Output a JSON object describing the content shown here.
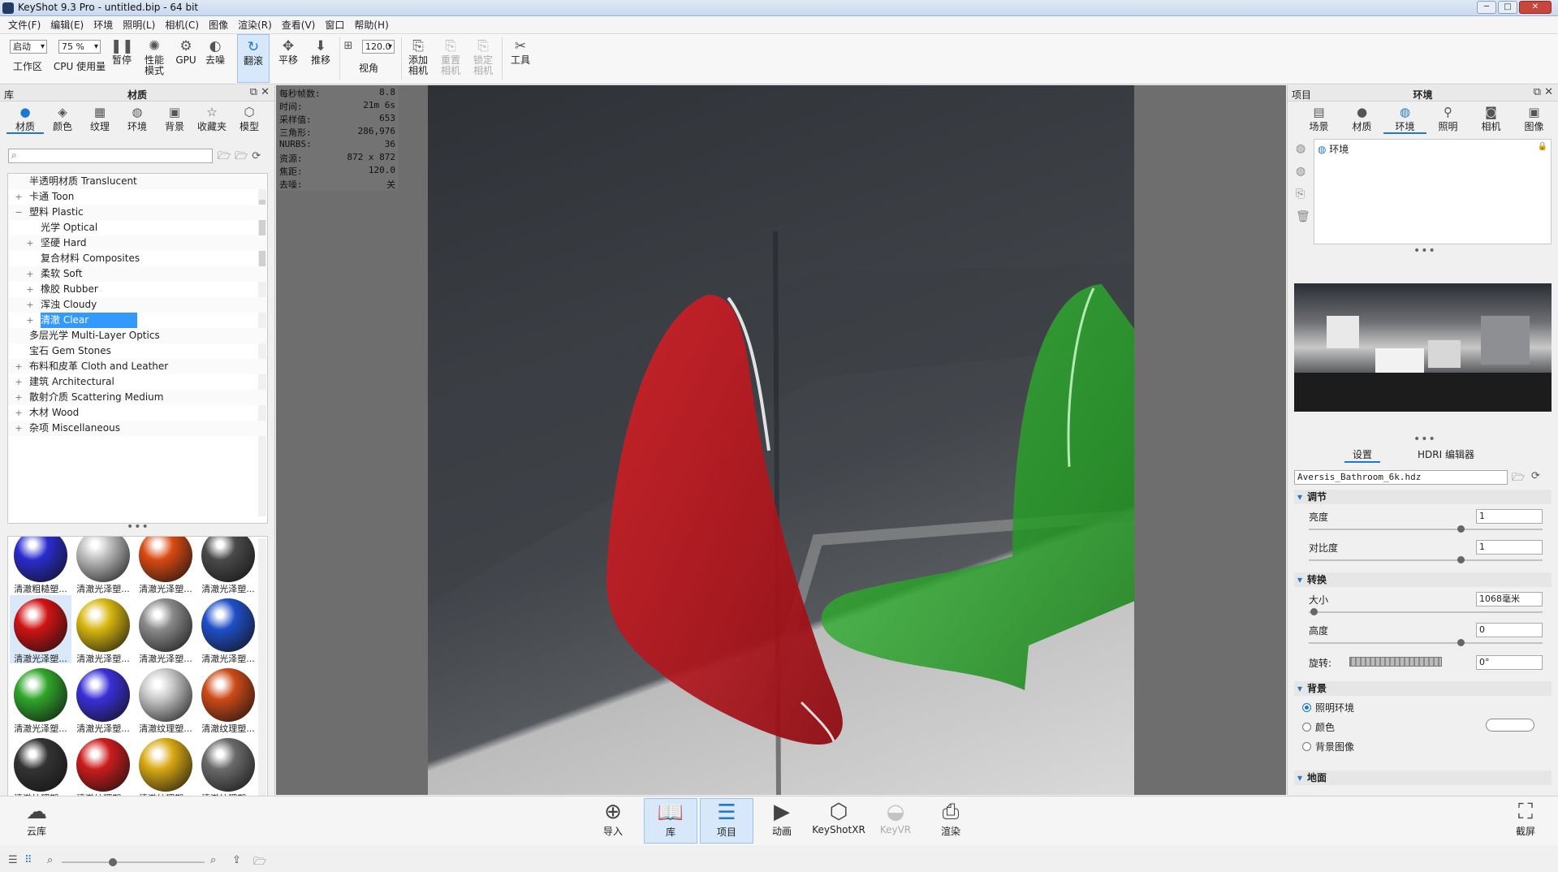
{
  "window": {
    "title": "KeyShot 9.3 Pro  - untitled.bip  - 64 bit",
    "controls": [
      "─",
      "□",
      "✕"
    ]
  },
  "menu": [
    "文件(F)",
    "编辑(E)",
    "环境",
    "照明(L)",
    "相机(C)",
    "图像",
    "渲染(R)",
    "查看(V)",
    "窗口",
    "帮助(H)"
  ],
  "toolbar": {
    "workspace_value": "启动",
    "workspace_label": "工作区",
    "cpu_value": "75 %",
    "cpu_label": "CPU 使用量",
    "pause": "暂停",
    "perf_mode": "性能\n模式",
    "gpu": "GPU",
    "denoise": "去噪",
    "tumble": "翻滚",
    "pan": "平移",
    "dolly": "推移",
    "fov_value": "120.0",
    "fov_label": "视角",
    "add_camera": "添加\n相机",
    "reset_camera": "重置\n相机",
    "lock_camera": "锁定\n相机",
    "tools": "工具"
  },
  "library": {
    "header_left": "库",
    "header_center": "材质",
    "tabs": [
      "材质",
      "颜色",
      "纹理",
      "环境",
      "背景",
      "收藏夹",
      "模型"
    ],
    "tree": [
      {
        "label": "半透明材质 Translucent",
        "level": 1,
        "exp": ""
      },
      {
        "label": "卡通 Toon",
        "level": 1,
        "exp": "+"
      },
      {
        "label": "塑料 Plastic",
        "level": 1,
        "exp": "−"
      },
      {
        "label": "光学 Optical",
        "level": 2,
        "exp": ""
      },
      {
        "label": "坚硬 Hard",
        "level": 2,
        "exp": "+"
      },
      {
        "label": "复合材料 Composites",
        "level": 2,
        "exp": ""
      },
      {
        "label": "柔软 Soft",
        "level": 2,
        "exp": "+"
      },
      {
        "label": "橡胶 Rubber",
        "level": 2,
        "exp": "+"
      },
      {
        "label": "浑浊 Cloudy",
        "level": 2,
        "exp": "+"
      },
      {
        "label": "清澈 Clear",
        "level": 2,
        "exp": "+",
        "selected": true
      },
      {
        "label": "多层光学 Multi-Layer Optics",
        "level": 1,
        "exp": ""
      },
      {
        "label": "宝石 Gem Stones",
        "level": 1,
        "exp": ""
      },
      {
        "label": "布料和皮革 Cloth and Leather",
        "level": 1,
        "exp": "+"
      },
      {
        "label": "建筑 Architectural",
        "level": 1,
        "exp": "+"
      },
      {
        "label": "散射介质 Scattering Medium",
        "level": 1,
        "exp": "+"
      },
      {
        "label": "木材 Wood",
        "level": 1,
        "exp": "+"
      },
      {
        "label": "杂项 Miscellaneous",
        "level": 1,
        "exp": "+"
      }
    ],
    "materials": [
      {
        "label": "清澈粗糙塑...",
        "color": "#2a2ccf"
      },
      {
        "label": "清澈光泽塑...",
        "color": "#bdbdbd"
      },
      {
        "label": "清澈光泽塑...",
        "color": "#d94a12"
      },
      {
        "label": "清澈光泽塑...",
        "color": "#4a4a4a"
      },
      {
        "label": "清澈光泽塑...",
        "color": "#d01313",
        "selected": true
      },
      {
        "label": "清澈光泽塑...",
        "color": "#d8b711"
      },
      {
        "label": "清澈光泽塑...",
        "color": "#8a8a8a"
      },
      {
        "label": "清澈光泽塑...",
        "color": "#1f4fc8"
      },
      {
        "label": "清澈光泽塑...",
        "color": "#2fa52a"
      },
      {
        "label": "清澈光泽塑...",
        "color": "#3a2fd8"
      },
      {
        "label": "清澈纹理塑...",
        "color": "#c8c8c8"
      },
      {
        "label": "清澈纹理塑...",
        "color": "#cc4a18"
      },
      {
        "label": "清澈纹理塑...",
        "color": "#333333"
      },
      {
        "label": "清澈纹理塑...",
        "color": "#cc1c1c"
      },
      {
        "label": "清澈纹理塑...",
        "color": "#d9a914"
      },
      {
        "label": "清澈纹理塑...",
        "color": "#6a6a6a"
      },
      {
        "label": "",
        "color": "#1b4ac4"
      },
      {
        "label": "",
        "color": "#28a828"
      },
      {
        "label": "",
        "color": "#3b24c8"
      }
    ]
  },
  "hud": [
    {
      "k": "每秒帧数:",
      "v": "8.8"
    },
    {
      "k": "时间:",
      "v": "21m 6s"
    },
    {
      "k": "采样值:",
      "v": "653"
    },
    {
      "k": "三角形:",
      "v": "286,976"
    },
    {
      "k": "NURBS:",
      "v": "36"
    },
    {
      "k": "资源:",
      "v": "872 x 872"
    },
    {
      "k": "焦距:",
      "v": "120.0"
    },
    {
      "k": "去噪:",
      "v": "关"
    }
  ],
  "project": {
    "header_left": "项目",
    "header_center": "环境",
    "tabs": [
      "场景",
      "材质",
      "环境",
      "照明",
      "相机",
      "图像"
    ],
    "env_item": "环境",
    "subtabs": [
      "设置",
      "HDRI 编辑器"
    ],
    "hdri_file": "Aversis_Bathroom_6k.hdz",
    "sections": {
      "adjust": "调节",
      "transform": "转换",
      "background": "背景",
      "ground": "地面"
    },
    "brightness_label": "亮度",
    "brightness_value": "1",
    "brightness_level": 0.65,
    "contrast_label": "对比度",
    "contrast_value": "1",
    "contrast_level": 0.65,
    "size_label": "大小",
    "size_value": "1068毫米",
    "size_level": 0.02,
    "height_label": "高度",
    "height_value": "0",
    "height_level": 0.65,
    "rotation_label": "旋转:",
    "rotation_value": "0°",
    "bg_options": [
      "照明环境",
      "颜色",
      "背景图像"
    ]
  },
  "bottombar": {
    "cloud": "云库",
    "import": "导入",
    "library": "库",
    "project": "项目",
    "animation": "动画",
    "keyshotxr": "KeyShotXR",
    "keyvr": "KeyVR",
    "render": "渲染",
    "screenshot": "截屏"
  },
  "colors": {
    "accent": "#1e78d0",
    "red_glass": "#c0141a",
    "green_glass": "#1c9a1c"
  }
}
